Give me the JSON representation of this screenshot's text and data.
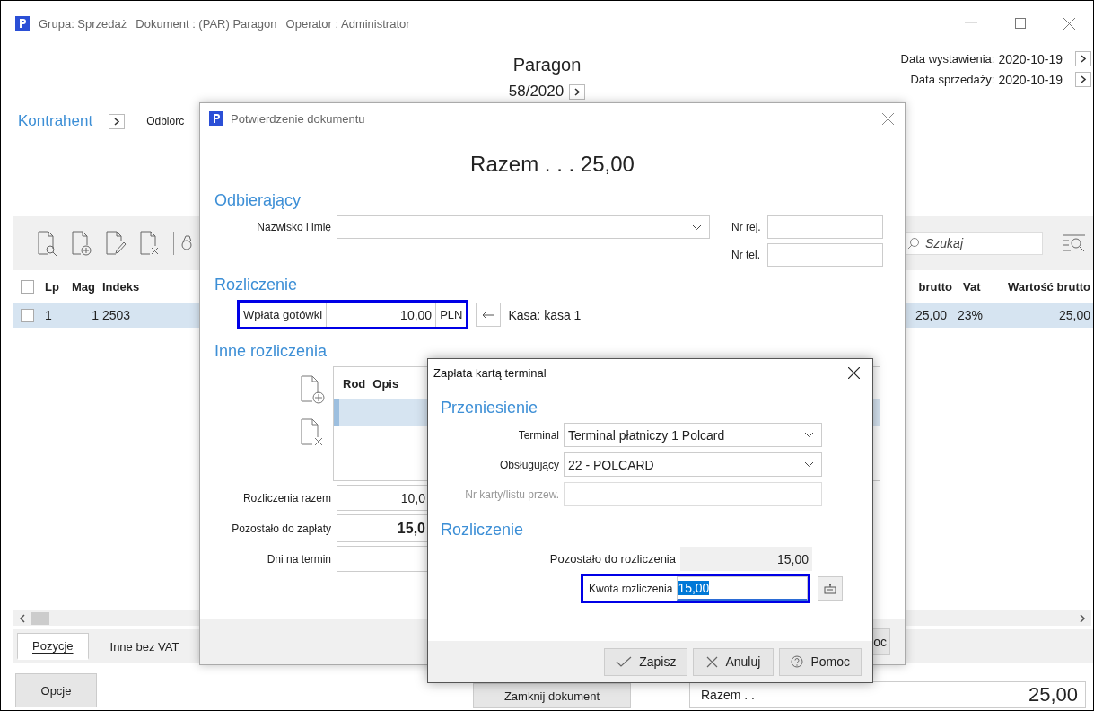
{
  "window": {
    "title_parts": [
      "Grupa: Sprzedaż",
      "Dokument : (PAR) Paragon",
      "Operator : Administrator"
    ]
  },
  "header": {
    "title": "Paragon",
    "number": "58/2020",
    "dates": [
      {
        "label": "Data wystawienia:",
        "value": "2020-10-19"
      },
      {
        "label": "Data sprzedaży:",
        "value": "2020-10-19"
      }
    ]
  },
  "kontrahent": {
    "label": "Kontrahent",
    "odbiorca_label": "Odbiorc"
  },
  "search": {
    "placeholder": "Szukaj"
  },
  "table": {
    "all_checked": false,
    "columns_left": [
      "Lp",
      "Mag",
      "Indeks"
    ],
    "columns_right": [
      "brutto",
      "Vat",
      "Wartość brutto"
    ],
    "rows": [
      {
        "selected": true,
        "checked": false,
        "lp": "1",
        "mag": "1",
        "indeks": "2503",
        "brutto": "25,00",
        "vat": "23%",
        "wartosc": "25,00"
      }
    ]
  },
  "tabs": [
    {
      "label": "Pozycje",
      "selected": true
    },
    {
      "label": "Inne bez VAT",
      "selected": false
    }
  ],
  "bottom": {
    "options_button": "Opcje",
    "close_button": "Zamknij dokument",
    "total_label": "Razem . .",
    "total_value": "25,00"
  },
  "confirm_dialog": {
    "title": "Potwierdzenie dokumentu",
    "total": "Razem . . . 25,00",
    "recipient": {
      "heading": "Odbierający",
      "name_label": "Nazwisko i imię",
      "fields": [
        {
          "label": "Nr rej."
        },
        {
          "label": "Nr tel."
        }
      ]
    },
    "settlement": {
      "heading": "Rozliczenie",
      "label": "Wpłata gotówki",
      "value": "10,00",
      "currency": "PLN",
      "cash_register": "Kasa: kasa 1"
    },
    "other": {
      "heading": "Inne rozliczenia",
      "columns": [
        "Rod",
        "Opis"
      ],
      "rows": [
        {
          "selected": true
        }
      ],
      "summary": [
        {
          "label": "Rozliczenia razem",
          "value": "10,0",
          "bold": false
        },
        {
          "label": "Pozostało do zapłaty",
          "value": "15,0",
          "bold": true
        },
        {
          "label": "Dni na termin",
          "bold": false
        }
      ]
    },
    "footer_button": "oc"
  },
  "card_dialog": {
    "title": "Zapłata kartą terminal",
    "transfer_heading": "Przeniesienie",
    "fields": [
      {
        "kind": "combo",
        "label": "Terminal",
        "value": "Terminal płatniczy 1 Polcard",
        "disabled": false
      },
      {
        "kind": "combo",
        "label": "Obsługujący",
        "value": "22 - POLCARD",
        "disabled": false
      },
      {
        "kind": "text",
        "label": "Nr karty/listu przew.",
        "disabled": true
      }
    ],
    "settlement_heading": "Rozliczenie",
    "remaining_label": "Pozostało do rozliczenia",
    "remaining_value": "15,00",
    "amount_label": "Kwota rozliczenia",
    "amount_value": "15,00",
    "buttons": [
      {
        "kind": "save",
        "label": "Zapisz"
      },
      {
        "kind": "cancel",
        "label": "Anuluj"
      },
      {
        "kind": "help",
        "label": "Pomoc"
      }
    ]
  }
}
